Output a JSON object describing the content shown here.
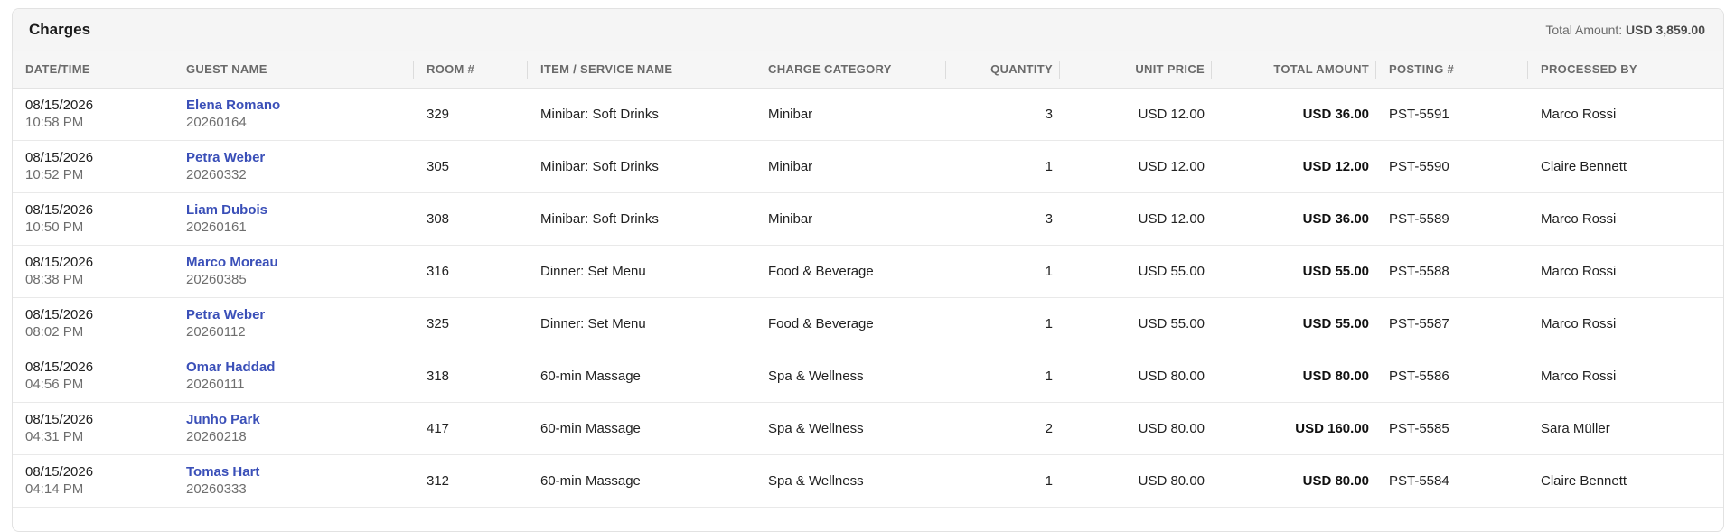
{
  "panel": {
    "title": "Charges",
    "total_label": "Total Amount:",
    "total_value": "USD 3,859.00"
  },
  "columns": {
    "datetime": "DATE/TIME",
    "guest": "GUEST NAME",
    "room": "ROOM #",
    "item": "ITEM / SERVICE NAME",
    "category": "CHARGE CATEGORY",
    "quantity": "QUANTITY",
    "unit_price": "UNIT PRICE",
    "total": "TOTAL AMOUNT",
    "posting": "POSTING #",
    "processed": "PROCESSED BY"
  },
  "rows": [
    {
      "date": "08/15/2026",
      "time": "10:58 PM",
      "guest": "Elena Romano",
      "guest_id": "20260164",
      "room": "329",
      "item": "Minibar: Soft Drinks",
      "category": "Minibar",
      "quantity": "3",
      "unit_price": "USD 12.00",
      "total": "USD 36.00",
      "posting": "PST-5591",
      "processed": "Marco Rossi"
    },
    {
      "date": "08/15/2026",
      "time": "10:52 PM",
      "guest": "Petra Weber",
      "guest_id": "20260332",
      "room": "305",
      "item": "Minibar: Soft Drinks",
      "category": "Minibar",
      "quantity": "1",
      "unit_price": "USD 12.00",
      "total": "USD 12.00",
      "posting": "PST-5590",
      "processed": "Claire Bennett"
    },
    {
      "date": "08/15/2026",
      "time": "10:50 PM",
      "guest": "Liam Dubois",
      "guest_id": "20260161",
      "room": "308",
      "item": "Minibar: Soft Drinks",
      "category": "Minibar",
      "quantity": "3",
      "unit_price": "USD 12.00",
      "total": "USD 36.00",
      "posting": "PST-5589",
      "processed": "Marco Rossi"
    },
    {
      "date": "08/15/2026",
      "time": "08:38 PM",
      "guest": "Marco Moreau",
      "guest_id": "20260385",
      "room": "316",
      "item": "Dinner: Set Menu",
      "category": "Food & Beverage",
      "quantity": "1",
      "unit_price": "USD 55.00",
      "total": "USD 55.00",
      "posting": "PST-5588",
      "processed": "Marco Rossi"
    },
    {
      "date": "08/15/2026",
      "time": "08:02 PM",
      "guest": "Petra Weber",
      "guest_id": "20260112",
      "room": "325",
      "item": "Dinner: Set Menu",
      "category": "Food & Beverage",
      "quantity": "1",
      "unit_price": "USD 55.00",
      "total": "USD 55.00",
      "posting": "PST-5587",
      "processed": "Marco Rossi"
    },
    {
      "date": "08/15/2026",
      "time": "04:56 PM",
      "guest": "Omar Haddad",
      "guest_id": "20260111",
      "room": "318",
      "item": "60-min Massage",
      "category": "Spa & Wellness",
      "quantity": "1",
      "unit_price": "USD 80.00",
      "total": "USD 80.00",
      "posting": "PST-5586",
      "processed": "Marco Rossi"
    },
    {
      "date": "08/15/2026",
      "time": "04:31 PM",
      "guest": "Junho Park",
      "guest_id": "20260218",
      "room": "417",
      "item": "60-min Massage",
      "category": "Spa & Wellness",
      "quantity": "2",
      "unit_price": "USD 80.00",
      "total": "USD 160.00",
      "posting": "PST-5585",
      "processed": "Sara Müller"
    },
    {
      "date": "08/15/2026",
      "time": "04:14 PM",
      "guest": "Tomas Hart",
      "guest_id": "20260333",
      "room": "312",
      "item": "60-min Massage",
      "category": "Spa & Wellness",
      "quantity": "1",
      "unit_price": "USD 80.00",
      "total": "USD 80.00",
      "posting": "PST-5584",
      "processed": "Claire Bennett"
    }
  ]
}
